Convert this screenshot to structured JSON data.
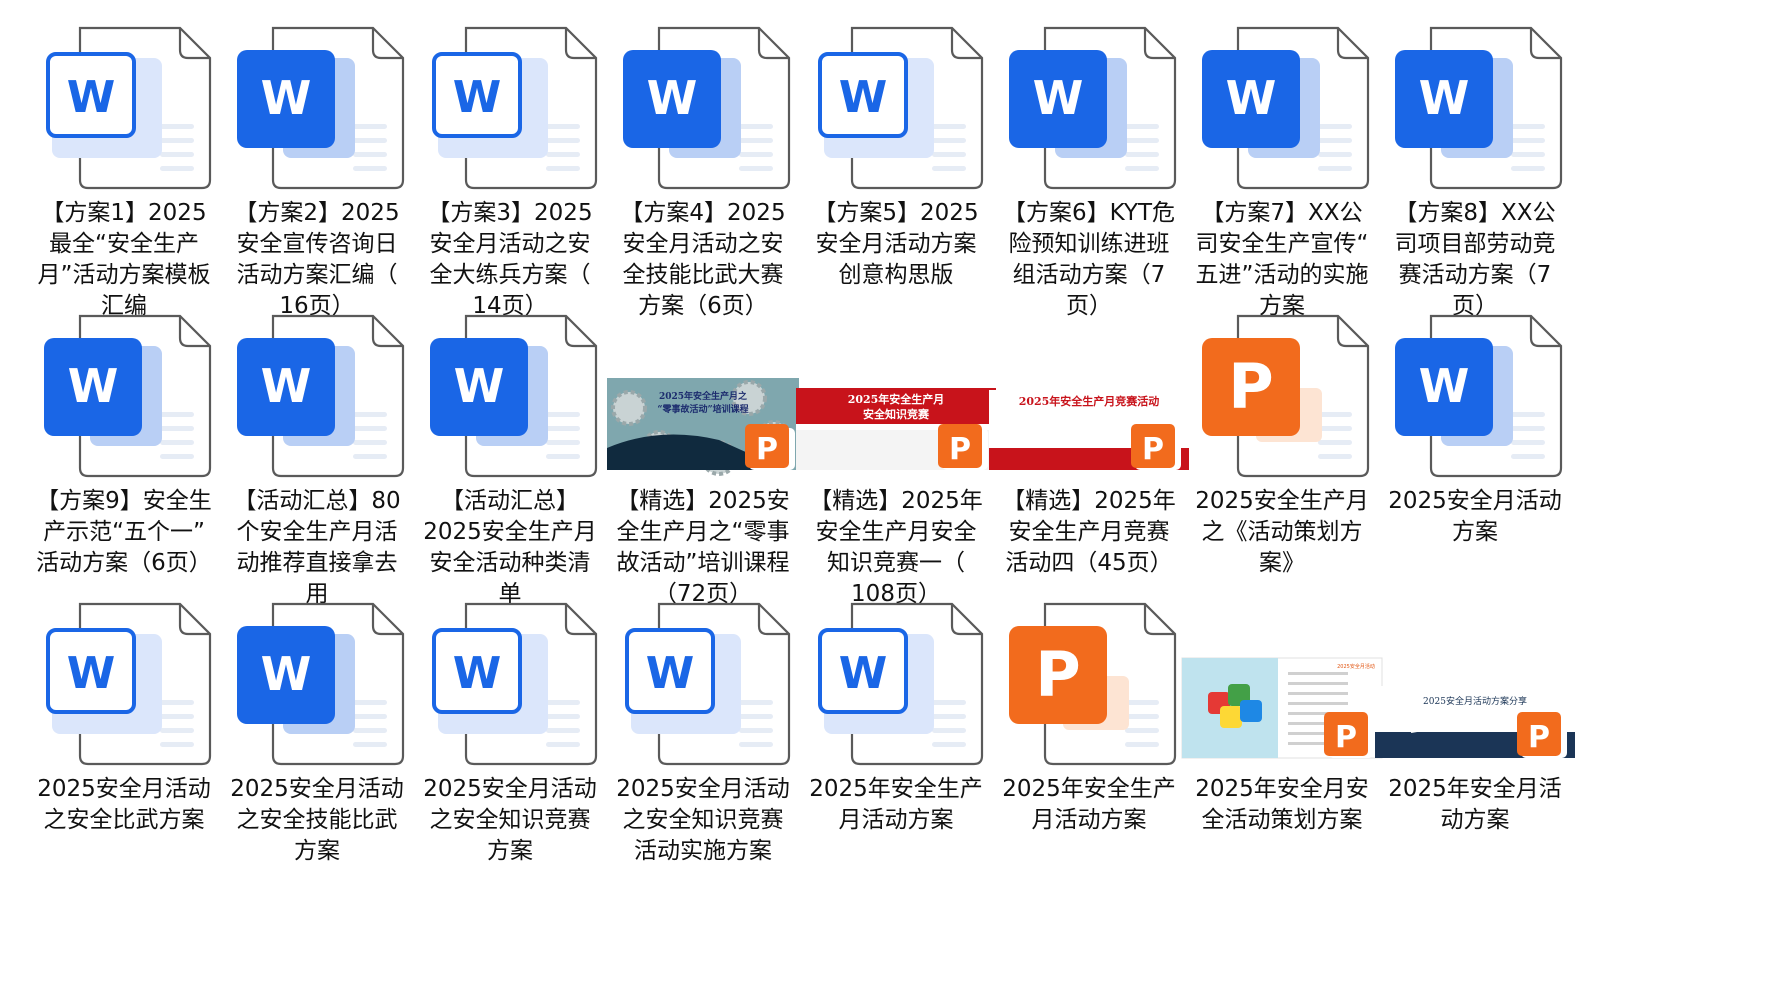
{
  "files": [
    {
      "kind": "word",
      "variant": "light",
      "name": "【方案1】2025\n最全“安全生产\n月”活动方案模板\n汇编"
    },
    {
      "kind": "word",
      "variant": "solid",
      "name": "【方案2】2025\n安全宣传咨询日\n活动方案汇编（\n16页）"
    },
    {
      "kind": "word",
      "variant": "light",
      "name": "【方案3】2025\n安全月活动之安\n全大练兵方案（\n14页）"
    },
    {
      "kind": "word",
      "variant": "solid",
      "name": "【方案4】2025\n安全月活动之安\n全技能比武大赛\n方案（6页）"
    },
    {
      "kind": "word",
      "variant": "light",
      "name": "【方案5】2025\n安全月活动方案\n创意构思版"
    },
    {
      "kind": "word",
      "variant": "solid",
      "name": "【方案6】KYT危\n险预知训练进班\n组活动方案（7\n页）"
    },
    {
      "kind": "word",
      "variant": "solid",
      "name": "【方案7】XX公\n司安全生产宣传“\n五进”活动的实施\n方案"
    },
    {
      "kind": "word",
      "variant": "solid",
      "name": "【方案8】XX公\n司项目部劳动竞\n赛活动方案（7\n页）"
    },
    {
      "kind": "word",
      "variant": "solid",
      "name": "【方案9】安全生\n产示范“五个一”\n活动方案（6页）"
    },
    {
      "kind": "word",
      "variant": "solid",
      "name": "【活动汇总】80\n个安全生产月活\n动推荐直接拿去\n用"
    },
    {
      "kind": "word",
      "variant": "solid",
      "name": "【活动汇总】\n2025安全生产月\n安全活动种类清\n单"
    },
    {
      "kind": "ppt-thumb",
      "thumb": "gears",
      "thumb_text": "2025年安全生产月之\n“零事故活动”培训课程",
      "name": "【精选】2025安\n全生产月之“零事\n故活动”培训课程\n（72页）"
    },
    {
      "kind": "ppt-thumb",
      "thumb": "redbanner",
      "thumb_text": "2025年安全生产月\n安全知识竞赛",
      "name": "【精选】2025年\n安全生产月安全\n知识竞赛一（\n108页）"
    },
    {
      "kind": "ppt-thumb",
      "thumb": "redtitle",
      "thumb_text": "2025年安全生产月竞赛活动",
      "name": "【精选】2025年\n安全生产月竞赛\n活动四（45页）"
    },
    {
      "kind": "ppt",
      "name": "2025安全生产月\n之《活动策划方\n案》"
    },
    {
      "kind": "word",
      "variant": "solid",
      "name": "2025安全月活动\n方案"
    },
    {
      "kind": "word",
      "variant": "light",
      "name": "2025安全月活动\n之安全比武方案"
    },
    {
      "kind": "word",
      "variant": "solid",
      "name": "2025安全月活动\n之安全技能比武\n方案"
    },
    {
      "kind": "word",
      "variant": "light",
      "name": "2025安全月活动\n之安全知识竞赛\n方案"
    },
    {
      "kind": "word",
      "variant": "light",
      "name": "2025安全月活动\n之安全知识竞赛\n活动实施方案"
    },
    {
      "kind": "word",
      "variant": "light",
      "name": "2025年安全生产\n月活动方案"
    },
    {
      "kind": "ppt",
      "name": "2025年安全生产\n月活动方案"
    },
    {
      "kind": "ppt-thumb",
      "thumb": "puzzle",
      "thumb_text": "2025安全月活动",
      "name": "2025年安全月安\n全活动策划方案"
    },
    {
      "kind": "ppt-thumb",
      "thumb": "book",
      "thumb_text": "2025安全月活动方案分享",
      "name": "2025年安全月活\n动方案"
    }
  ],
  "icon_letters": {
    "word": "W",
    "ppt": "P"
  },
  "colors": {
    "word_blue": "#1a66e6",
    "word_blue_dark": "#0f4fc4",
    "ppt_orange": "#f26b1d",
    "ppt_orange_dark": "#e25511",
    "page_stroke": "#5a5a5a",
    "banner_red": "#c8131b"
  }
}
